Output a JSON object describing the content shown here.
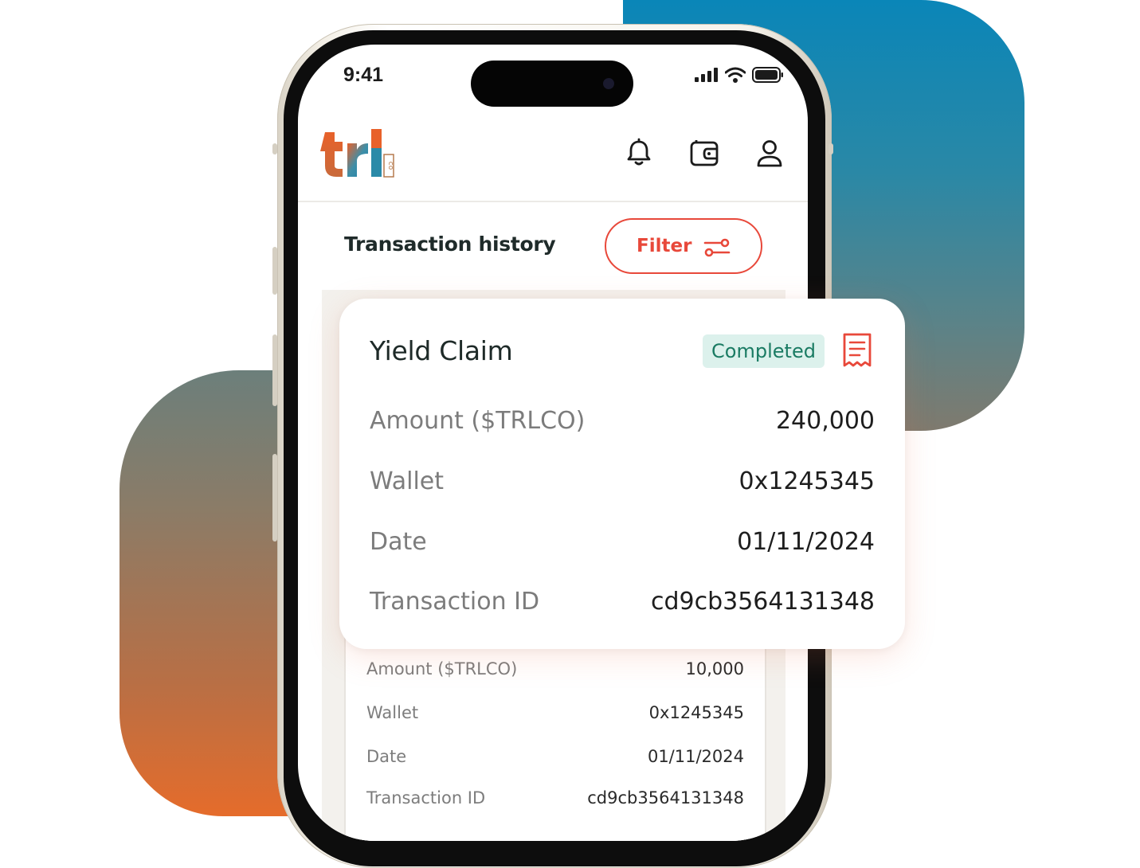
{
  "status_bar": {
    "time": "9:41"
  },
  "header": {
    "logo_text": "trl",
    "logo_suffix": "co",
    "icons": [
      "bell-icon",
      "wallet-icon",
      "user-icon"
    ]
  },
  "history": {
    "title": "Transaction history",
    "filter_label": "Filter"
  },
  "transaction": {
    "title": "Yield Claim",
    "status": "Completed",
    "rows": [
      {
        "label": "Amount ($TRLCO)",
        "value": "240,000"
      },
      {
        "label": "Wallet",
        "value": "0x1245345"
      },
      {
        "label": "Date",
        "value": "01/11/2024"
      },
      {
        "label": "Transaction ID",
        "value": "cd9cb3564131348"
      }
    ]
  },
  "background_transaction": {
    "rows": [
      {
        "label": "Amount ($TRLCO)",
        "value": "10,000"
      },
      {
        "label": "Wallet",
        "value": "0x1245345"
      },
      {
        "label": "Date",
        "value": "01/11/2024"
      },
      {
        "label": "Transaction ID",
        "value": "cd9cb3564131348"
      }
    ]
  },
  "colors": {
    "accent": "#e8483a",
    "success_bg": "#dcf1ec",
    "success_text": "#1a7b63",
    "blob_blue": "#0a86b8",
    "blob_orange": "#e56c2b"
  }
}
